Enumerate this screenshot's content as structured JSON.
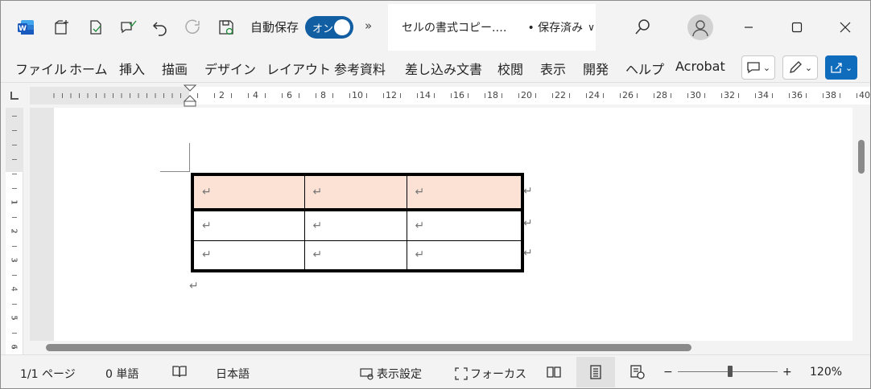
{
  "app": {
    "name": "Word",
    "logo_letter": "W"
  },
  "titlebar": {
    "autosave_label": "自動保存",
    "autosave_toggle": "オン",
    "more": "»",
    "doc_title": "セルの書式コピー.…",
    "save_status": "• 保存済み",
    "save_chevron": "∨"
  },
  "ribbon": {
    "tabs": [
      "ファイル",
      "ホーム",
      "挿入",
      "描画",
      "デザイン",
      "レイアウト",
      "参考資料",
      "差し込み文書",
      "校閲",
      "表示",
      "開発",
      "ヘルプ",
      "Acrobat"
    ]
  },
  "ruler": {
    "h_labels": [
      "2",
      "4",
      "6",
      "8",
      "10",
      "12",
      "14",
      "16",
      "18",
      "20",
      "22",
      "24",
      "26",
      "28",
      "30",
      "32",
      "34",
      "36",
      "38",
      "40"
    ],
    "v_labels": [
      "1",
      "2",
      "3",
      "4",
      "5",
      "6"
    ]
  },
  "document": {
    "para_mark": "↵",
    "table": {
      "rows": [
        [
          "↵",
          "↵",
          "↵"
        ],
        [
          "↵",
          "↵",
          "↵"
        ],
        [
          "↵",
          "↵",
          "↵"
        ]
      ],
      "header_fill": "#fbe2d5"
    }
  },
  "statusbar": {
    "page": "1/1 ページ",
    "words": "0 単語",
    "language": "日本語",
    "display_settings": "表示設定",
    "focus": "フォーカス",
    "zoom_minus": "−",
    "zoom_plus": "+",
    "zoom": "120%"
  },
  "colors": {
    "accent": "#0f6cbd",
    "toggle": "#115ea3",
    "header_cell": "#fbe2d5"
  }
}
